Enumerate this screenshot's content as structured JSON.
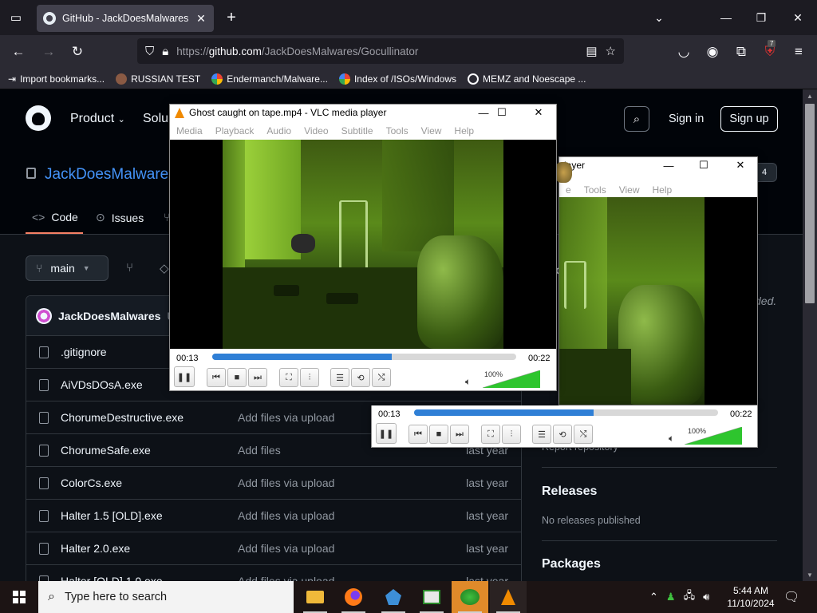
{
  "browser": {
    "tab_title": "GitHub - JackDoesMalwares/Gocullinator",
    "url_scheme": "https://",
    "url_host": "github.com",
    "url_path": "/JackDoesMalwares/Gocullinator",
    "extension_badge": "7",
    "bookmarks": [
      {
        "label": "Import bookmarks...",
        "icon": "import-icon"
      },
      {
        "label": "RUSSIAN TEST",
        "icon": "bookmark-favicon"
      },
      {
        "label": "Endermanch/Malware...",
        "icon": "google-favicon"
      },
      {
        "label": "Index of /ISOs/Windows",
        "icon": "google-favicon"
      },
      {
        "label": "MEMZ and Noescape ...",
        "icon": "globe-icon"
      }
    ]
  },
  "github": {
    "nav": {
      "product": "Product",
      "solutions": "Solu",
      "sign_in": "Sign in",
      "sign_up": "Sign up"
    },
    "repo_owner": "JackDoesMalwares",
    "star_count": "4",
    "tabs": {
      "code": "Code",
      "issues": "Issues"
    },
    "branch": "main",
    "commit_author": "JackDoesMalwares",
    "commit_more": "U",
    "files": [
      {
        "name": ".gitignore",
        "msg": "",
        "date": ""
      },
      {
        "name": "AiVDsDOsA.exe",
        "msg": "",
        "date": ""
      },
      {
        "name": "ChorumeDestructive.exe",
        "msg": "Add files via upload",
        "date": ""
      },
      {
        "name": "ChorumeSafe.exe",
        "msg": "Add files",
        "date": "last year"
      },
      {
        "name": "ColorCs.exe",
        "msg": "Add files via upload",
        "date": "last year"
      },
      {
        "name": "Halter 1.5 [OLD].exe",
        "msg": "Add files via upload",
        "date": "last year"
      },
      {
        "name": "Halter 2.0.exe",
        "msg": "Add files via upload",
        "date": "last year"
      },
      {
        "name": "Halter [OLD] 1.0.exe",
        "msg": "Add files via upload",
        "date": "last year"
      }
    ],
    "sidebar": {
      "about_fragment": "o",
      "desc_fragment": "ded.",
      "report": "Report repository",
      "releases_heading": "Releases",
      "releases_text": "No releases published",
      "packages_heading": "Packages"
    }
  },
  "vlc_main": {
    "title": "Ghost caught on tape.mp4 - VLC media player",
    "menu": [
      "Media",
      "Playback",
      "Audio",
      "Video",
      "Subtitle",
      "Tools",
      "View",
      "Help"
    ],
    "elapsed": "00:13",
    "total": "00:22",
    "progress": 0.59,
    "volume_label": "100%",
    "volume": 1.0
  },
  "vlc_back": {
    "title": "layer",
    "menu": [
      "e",
      "Tools",
      "View",
      "Help"
    ],
    "elapsed": "00:13",
    "total": "00:22",
    "progress": 0.59,
    "volume_label": "100%",
    "volume": 1.0
  },
  "taskbar": {
    "search_placeholder": "Type here to search",
    "time": "5:44 AM",
    "date": "11/10/2024"
  }
}
